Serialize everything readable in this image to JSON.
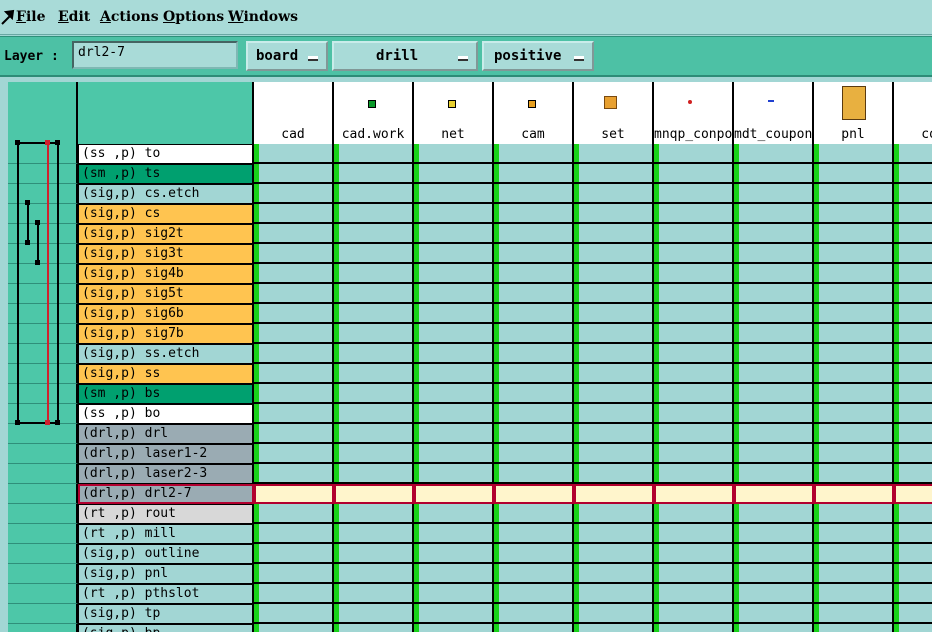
{
  "menu": [
    "File",
    "Edit",
    "Actions",
    "Options",
    "Windows"
  ],
  "toolbar": {
    "layer_label": "Layer :",
    "layer_value": "drl2-7",
    "context": "board",
    "type": "drill",
    "polarity": "positive"
  },
  "columns": [
    {
      "label": "cad",
      "icon": ""
    },
    {
      "label": "cad.work",
      "icon": "green-square-icon"
    },
    {
      "label": "net",
      "icon": "yellow-square-icon"
    },
    {
      "label": "cam",
      "icon": "orange-square-icon"
    },
    {
      "label": "set",
      "icon": "grid-board-icon"
    },
    {
      "label": "mnqp_conpo",
      "icon": "red-dot-icon"
    },
    {
      "label": "mdt_coupon",
      "icon": "blue-dash-icon"
    },
    {
      "label": "pnl",
      "icon": "panel-board-icon"
    },
    {
      "label": "con",
      "icon": ""
    }
  ],
  "layers": [
    {
      "label": "(ss ,p) to",
      "color": "white"
    },
    {
      "label": "(sm ,p) ts",
      "color": "green"
    },
    {
      "label": "(sig,p) cs.etch",
      "color": "teal"
    },
    {
      "label": "(sig,p) cs",
      "color": "orange"
    },
    {
      "label": "(sig,p) sig2t",
      "color": "orange"
    },
    {
      "label": "(sig,p) sig3t",
      "color": "orange"
    },
    {
      "label": "(sig,p) sig4b",
      "color": "orange"
    },
    {
      "label": "(sig,p) sig5t",
      "color": "orange"
    },
    {
      "label": "(sig,p) sig6b",
      "color": "orange"
    },
    {
      "label": "(sig,p) sig7b",
      "color": "orange"
    },
    {
      "label": "(sig,p) ss.etch",
      "color": "teal"
    },
    {
      "label": "(sig,p) ss",
      "color": "orange"
    },
    {
      "label": "(sm ,p) bs",
      "color": "green"
    },
    {
      "label": "(ss ,p) bo",
      "color": "white"
    },
    {
      "label": "(drl,p) drl",
      "color": "gray"
    },
    {
      "label": "(drl,p) laser1-2",
      "color": "gray"
    },
    {
      "label": "(drl,p) laser2-3",
      "color": "gray"
    },
    {
      "label": "(drl,p) drl2-7",
      "color": "sel"
    },
    {
      "label": "(rt ,p) rout",
      "color": "lgray"
    },
    {
      "label": "(rt ,p) mill",
      "color": "teal"
    },
    {
      "label": "(sig,p) outline",
      "color": "teal"
    },
    {
      "label": "(sig,p) pnl",
      "color": "teal"
    },
    {
      "label": "(rt ,p) pthslot",
      "color": "teal"
    },
    {
      "label": "(sig,p) tp",
      "color": "teal"
    },
    {
      "label": "(sig,p) bp",
      "color": "teal"
    }
  ],
  "selected_layer": "drl2-7",
  "colors": {
    "accent_teal": "#4dc7a8",
    "board_green": "#00a06f",
    "signal_orange": "#ffc450",
    "drill_gray": "#9aabb3",
    "selection_red": "#b2002f",
    "ok_green": "#19d21a"
  }
}
